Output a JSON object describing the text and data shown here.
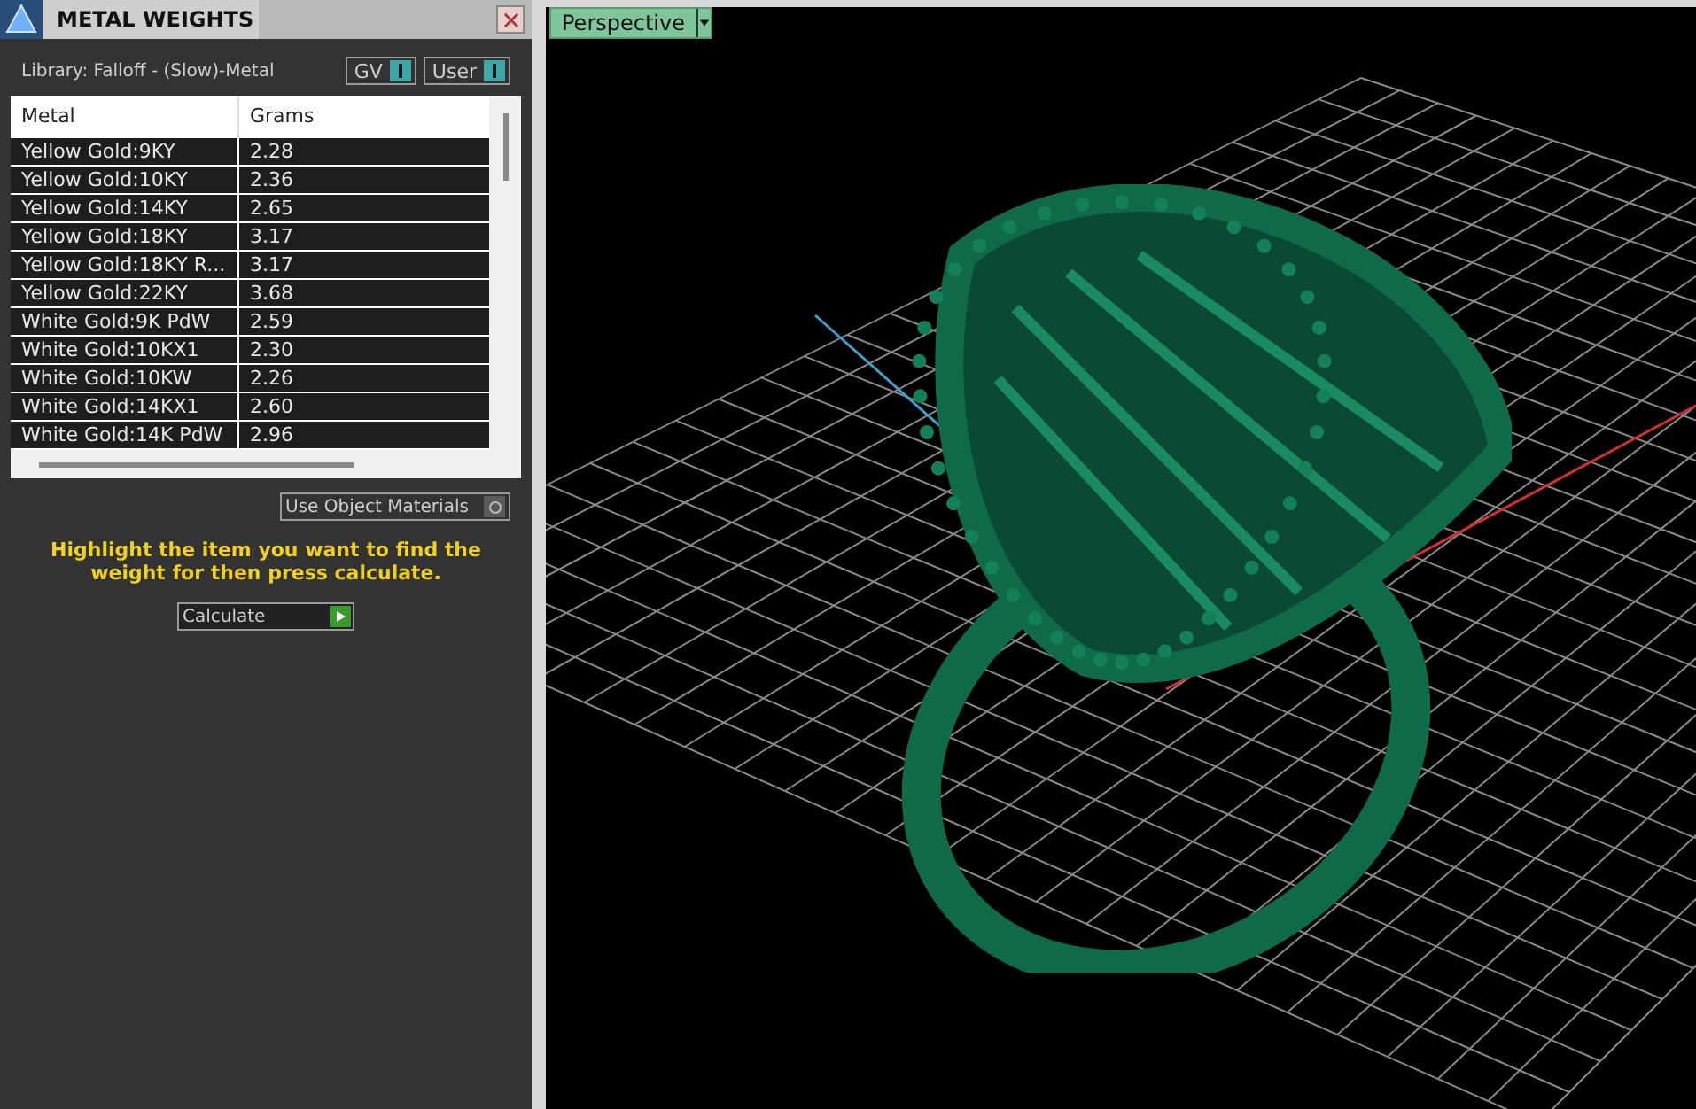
{
  "panel": {
    "title": "METAL WEIGHTS",
    "library": "Library: Falloff - (Slow)-Metal",
    "toggles": [
      {
        "label": "GV",
        "on": true
      },
      {
        "label": "User",
        "on": true
      }
    ],
    "table": {
      "columns": [
        "Metal",
        "Grams"
      ],
      "rows": [
        {
          "metal": "Yellow Gold:9KY",
          "grams": "2.28"
        },
        {
          "metal": "Yellow Gold:10KY",
          "grams": "2.36"
        },
        {
          "metal": "Yellow Gold:14KY",
          "grams": "2.65"
        },
        {
          "metal": "Yellow Gold:18KY",
          "grams": "3.17"
        },
        {
          "metal": "Yellow Gold:18KY R...",
          "grams": "3.17"
        },
        {
          "metal": "Yellow Gold:22KY",
          "grams": "3.68"
        },
        {
          "metal": "White Gold:9K PdW",
          "grams": "2.59"
        },
        {
          "metal": "White Gold:10KX1",
          "grams": "2.30"
        },
        {
          "metal": "White Gold:10KW",
          "grams": "2.26"
        },
        {
          "metal": "White Gold:14KX1",
          "grams": "2.60"
        },
        {
          "metal": "White Gold:14K PdW",
          "grams": "2.96"
        }
      ]
    },
    "use_object_materials": {
      "label": "Use Object Materials",
      "on": false
    },
    "hint": "Highlight the item you want to find the weight for then press calculate.",
    "calculate_button": "Calculate"
  },
  "viewport": {
    "view_menu": "Perspective"
  }
}
